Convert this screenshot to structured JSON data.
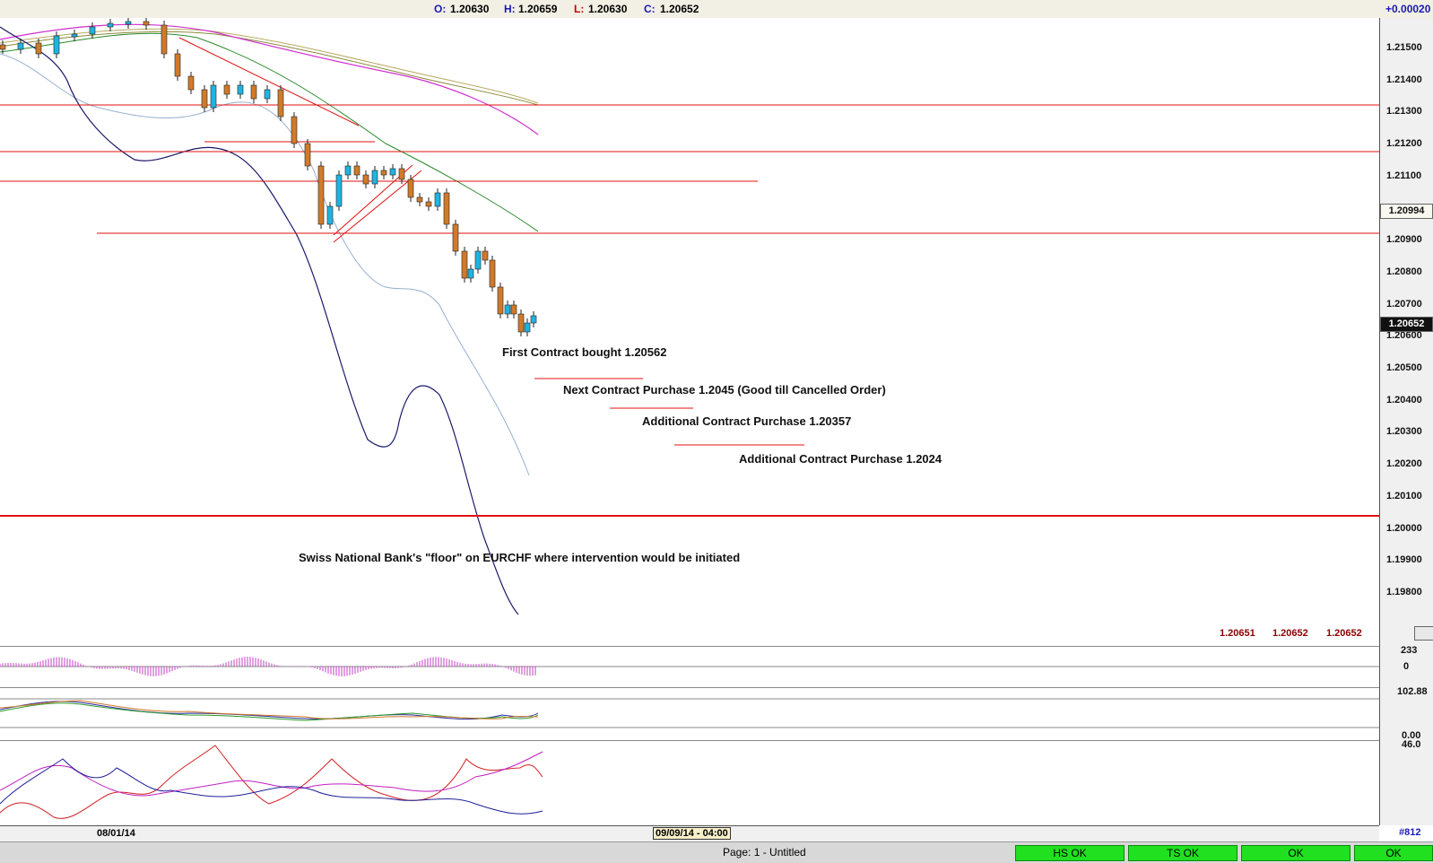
{
  "topbar": {
    "o_label": "O:",
    "o_value": "1.20630",
    "h_label": "H:",
    "h_value": "1.20659",
    "l_label": "L:",
    "l_value": "1.20630",
    "c_label": "C:",
    "c_value": "1.20652",
    "change": "+0.00020"
  },
  "price_axis": {
    "labels": [
      "1.21500",
      "1.21400",
      "1.21300",
      "1.21200",
      "1.21100",
      "1.20900",
      "1.20800",
      "1.20700",
      "1.20600",
      "1.20500",
      "1.20400",
      "1.20300",
      "1.20200",
      "1.20100",
      "1.20000",
      "1.19900",
      "1.19800"
    ],
    "marker_upper": "1.20994",
    "marker_current": "1.20652"
  },
  "annotations": {
    "first": "First Contract bought 1.20562",
    "next": "Next Contract Purchase 1.2045 (Good till Cancelled Order)",
    "additional1": "Additional Contract Purchase 1.20357",
    "additional2": "Additional Contract Purchase 1.2024",
    "floor": "Swiss National Bank's \"floor\" on EURCHF where intervention would be initiated"
  },
  "corner_values": [
    "1.20651",
    "1.20652",
    "1.20652"
  ],
  "indicator_axes": {
    "panel1_top": "233",
    "panel1_zero": "0",
    "panel2_top": "102.88",
    "panel2_bottom": "0.00",
    "panel3_top": "46.0"
  },
  "datebar": {
    "date1": "08/01/14",
    "date2": "09/09/14 - 04:00"
  },
  "bar_count": "#812",
  "statusbar": {
    "page": "Page: 1 - Untitled",
    "cells": [
      "HS OK",
      "TS OK",
      "OK",
      "OK"
    ]
  },
  "colors": {
    "bull": "#1fb4e0",
    "bear": "#d07a2a",
    "levels": "#e01010",
    "bollinger": "#1a1a6a"
  }
}
